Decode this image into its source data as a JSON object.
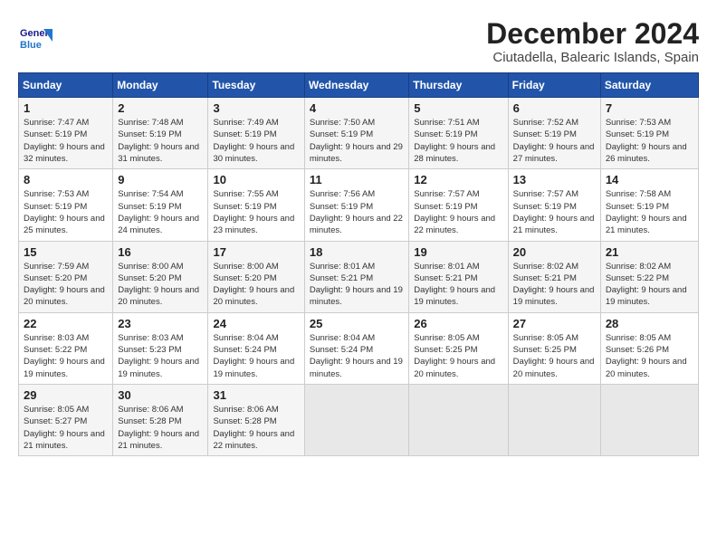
{
  "header": {
    "logo_general": "General",
    "logo_blue": "Blue",
    "month_title": "December 2024",
    "location": "Ciutadella, Balearic Islands, Spain"
  },
  "calendar": {
    "days_of_week": [
      "Sunday",
      "Monday",
      "Tuesday",
      "Wednesday",
      "Thursday",
      "Friday",
      "Saturday"
    ],
    "weeks": [
      [
        null,
        null,
        null,
        null,
        {
          "day": "5",
          "sunrise": "Sunrise: 7:51 AM",
          "sunset": "Sunset: 5:19 PM",
          "daylight": "Daylight: 9 hours and 28 minutes."
        },
        {
          "day": "6",
          "sunrise": "Sunrise: 7:52 AM",
          "sunset": "Sunset: 5:19 PM",
          "daylight": "Daylight: 9 hours and 27 minutes."
        },
        {
          "day": "7",
          "sunrise": "Sunrise: 7:53 AM",
          "sunset": "Sunset: 5:19 PM",
          "daylight": "Daylight: 9 hours and 26 minutes."
        }
      ],
      [
        {
          "day": "1",
          "sunrise": "Sunrise: 7:47 AM",
          "sunset": "Sunset: 5:19 PM",
          "daylight": "Daylight: 9 hours and 32 minutes."
        },
        {
          "day": "2",
          "sunrise": "Sunrise: 7:48 AM",
          "sunset": "Sunset: 5:19 PM",
          "daylight": "Daylight: 9 hours and 31 minutes."
        },
        {
          "day": "3",
          "sunrise": "Sunrise: 7:49 AM",
          "sunset": "Sunset: 5:19 PM",
          "daylight": "Daylight: 9 hours and 30 minutes."
        },
        {
          "day": "4",
          "sunrise": "Sunrise: 7:50 AM",
          "sunset": "Sunset: 5:19 PM",
          "daylight": "Daylight: 9 hours and 29 minutes."
        },
        {
          "day": "5",
          "sunrise": "Sunrise: 7:51 AM",
          "sunset": "Sunset: 5:19 PM",
          "daylight": "Daylight: 9 hours and 28 minutes."
        },
        {
          "day": "6",
          "sunrise": "Sunrise: 7:52 AM",
          "sunset": "Sunset: 5:19 PM",
          "daylight": "Daylight: 9 hours and 27 minutes."
        },
        {
          "day": "7",
          "sunrise": "Sunrise: 7:53 AM",
          "sunset": "Sunset: 5:19 PM",
          "daylight": "Daylight: 9 hours and 26 minutes."
        }
      ],
      [
        {
          "day": "8",
          "sunrise": "Sunrise: 7:53 AM",
          "sunset": "Sunset: 5:19 PM",
          "daylight": "Daylight: 9 hours and 25 minutes."
        },
        {
          "day": "9",
          "sunrise": "Sunrise: 7:54 AM",
          "sunset": "Sunset: 5:19 PM",
          "daylight": "Daylight: 9 hours and 24 minutes."
        },
        {
          "day": "10",
          "sunrise": "Sunrise: 7:55 AM",
          "sunset": "Sunset: 5:19 PM",
          "daylight": "Daylight: 9 hours and 23 minutes."
        },
        {
          "day": "11",
          "sunrise": "Sunrise: 7:56 AM",
          "sunset": "Sunset: 5:19 PM",
          "daylight": "Daylight: 9 hours and 22 minutes."
        },
        {
          "day": "12",
          "sunrise": "Sunrise: 7:57 AM",
          "sunset": "Sunset: 5:19 PM",
          "daylight": "Daylight: 9 hours and 22 minutes."
        },
        {
          "day": "13",
          "sunrise": "Sunrise: 7:57 AM",
          "sunset": "Sunset: 5:19 PM",
          "daylight": "Daylight: 9 hours and 21 minutes."
        },
        {
          "day": "14",
          "sunrise": "Sunrise: 7:58 AM",
          "sunset": "Sunset: 5:19 PM",
          "daylight": "Daylight: 9 hours and 21 minutes."
        }
      ],
      [
        {
          "day": "15",
          "sunrise": "Sunrise: 7:59 AM",
          "sunset": "Sunset: 5:20 PM",
          "daylight": "Daylight: 9 hours and 20 minutes."
        },
        {
          "day": "16",
          "sunrise": "Sunrise: 8:00 AM",
          "sunset": "Sunset: 5:20 PM",
          "daylight": "Daylight: 9 hours and 20 minutes."
        },
        {
          "day": "17",
          "sunrise": "Sunrise: 8:00 AM",
          "sunset": "Sunset: 5:20 PM",
          "daylight": "Daylight: 9 hours and 20 minutes."
        },
        {
          "day": "18",
          "sunrise": "Sunrise: 8:01 AM",
          "sunset": "Sunset: 5:21 PM",
          "daylight": "Daylight: 9 hours and 19 minutes."
        },
        {
          "day": "19",
          "sunrise": "Sunrise: 8:01 AM",
          "sunset": "Sunset: 5:21 PM",
          "daylight": "Daylight: 9 hours and 19 minutes."
        },
        {
          "day": "20",
          "sunrise": "Sunrise: 8:02 AM",
          "sunset": "Sunset: 5:21 PM",
          "daylight": "Daylight: 9 hours and 19 minutes."
        },
        {
          "day": "21",
          "sunrise": "Sunrise: 8:02 AM",
          "sunset": "Sunset: 5:22 PM",
          "daylight": "Daylight: 9 hours and 19 minutes."
        }
      ],
      [
        {
          "day": "22",
          "sunrise": "Sunrise: 8:03 AM",
          "sunset": "Sunset: 5:22 PM",
          "daylight": "Daylight: 9 hours and 19 minutes."
        },
        {
          "day": "23",
          "sunrise": "Sunrise: 8:03 AM",
          "sunset": "Sunset: 5:23 PM",
          "daylight": "Daylight: 9 hours and 19 minutes."
        },
        {
          "day": "24",
          "sunrise": "Sunrise: 8:04 AM",
          "sunset": "Sunset: 5:24 PM",
          "daylight": "Daylight: 9 hours and 19 minutes."
        },
        {
          "day": "25",
          "sunrise": "Sunrise: 8:04 AM",
          "sunset": "Sunset: 5:24 PM",
          "daylight": "Daylight: 9 hours and 19 minutes."
        },
        {
          "day": "26",
          "sunrise": "Sunrise: 8:05 AM",
          "sunset": "Sunset: 5:25 PM",
          "daylight": "Daylight: 9 hours and 20 minutes."
        },
        {
          "day": "27",
          "sunrise": "Sunrise: 8:05 AM",
          "sunset": "Sunset: 5:25 PM",
          "daylight": "Daylight: 9 hours and 20 minutes."
        },
        {
          "day": "28",
          "sunrise": "Sunrise: 8:05 AM",
          "sunset": "Sunset: 5:26 PM",
          "daylight": "Daylight: 9 hours and 20 minutes."
        }
      ],
      [
        {
          "day": "29",
          "sunrise": "Sunrise: 8:05 AM",
          "sunset": "Sunset: 5:27 PM",
          "daylight": "Daylight: 9 hours and 21 minutes."
        },
        {
          "day": "30",
          "sunrise": "Sunrise: 8:06 AM",
          "sunset": "Sunset: 5:28 PM",
          "daylight": "Daylight: 9 hours and 21 minutes."
        },
        {
          "day": "31",
          "sunrise": "Sunrise: 8:06 AM",
          "sunset": "Sunset: 5:28 PM",
          "daylight": "Daylight: 9 hours and 22 minutes."
        },
        null,
        null,
        null,
        null
      ]
    ]
  }
}
